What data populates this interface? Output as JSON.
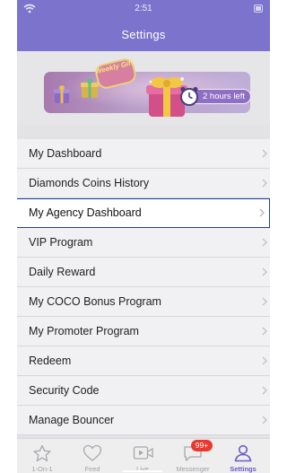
{
  "status_bar": {
    "time": "2:51"
  },
  "header": {
    "title": "Settings"
  },
  "banner": {
    "badge_text": "Weekly Gift",
    "timer_text": "2 hours left"
  },
  "menu": {
    "items": [
      {
        "label": "My Dashboard"
      },
      {
        "label": "Diamonds Coins History"
      },
      {
        "label": "My Agency Dashboard"
      },
      {
        "label": "VIP Program"
      },
      {
        "label": "Daily Reward"
      },
      {
        "label": "My COCO Bonus Program"
      },
      {
        "label": "My Promoter Program"
      },
      {
        "label": "Redeem"
      },
      {
        "label": "Security Code"
      },
      {
        "label": "Manage Bouncer"
      }
    ],
    "active_index": 2
  },
  "tabbar": {
    "tabs": [
      {
        "label": "1-On-1",
        "icon": "star-icon"
      },
      {
        "label": "Feed",
        "icon": "heart-icon"
      },
      {
        "label": "Live",
        "icon": "video-icon"
      },
      {
        "label": "Messenger",
        "icon": "chat-icon",
        "badge": "99+"
      },
      {
        "label": "Settings",
        "icon": "person-icon"
      }
    ],
    "active_tab": "Settings"
  },
  "colors": {
    "accent": "#6a5bc7",
    "header_bg": "#7b73cc",
    "badge_red": "#e8392e",
    "selection_border": "#1f3fa8"
  }
}
